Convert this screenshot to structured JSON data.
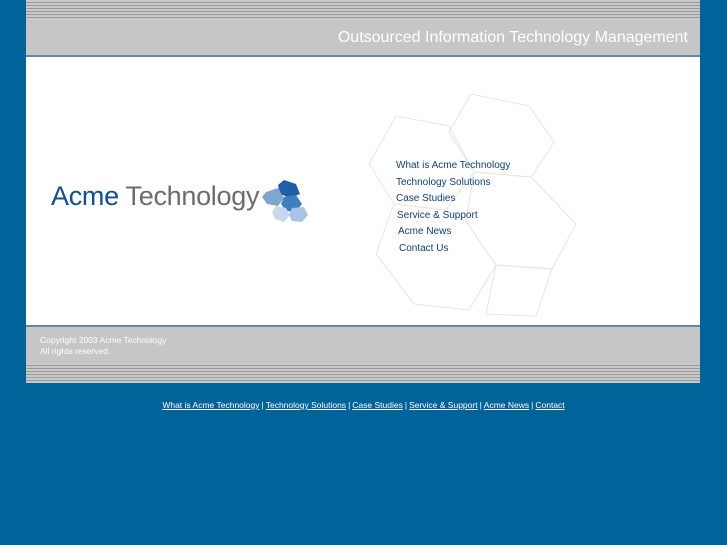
{
  "header": {
    "tagline": "Outsourced Information Technology Management"
  },
  "logo": {
    "part1": "Acme",
    "part2": "Technology"
  },
  "nav": {
    "items": [
      "What is Acme Technology",
      "Technology Solutions",
      "Case Studies",
      "Service & Support",
      "Acme News",
      "Contact Us"
    ]
  },
  "footer": {
    "copyright_line1": "Copyright 2003 Acme Technology",
    "copyright_line2": "All rights reserved"
  },
  "bottom_links": {
    "items": [
      "What is Acme Technology",
      "Technology Solutions",
      "Case Studies",
      "Service & Support",
      "Acme News",
      "Contact"
    ],
    "separator": "|"
  },
  "colors": {
    "page_background": "#00639a",
    "brand_blue": "#0f4f97",
    "header_gray": "#c6c6c6",
    "rule_blue": "#5f87b2"
  }
}
